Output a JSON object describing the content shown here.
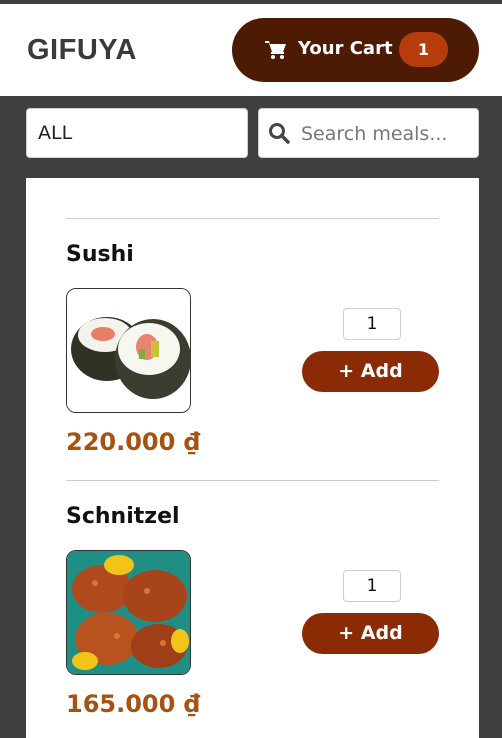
{
  "header": {
    "logo": "GIFUYA",
    "cart": {
      "label": "Your Cart",
      "count": "1",
      "icon": "shopping-cart-icon"
    }
  },
  "filters": {
    "category": "ALL",
    "search": {
      "placeholder": "Search meals...",
      "icon": "search-icon"
    }
  },
  "meals": [
    {
      "name": "Sushi",
      "quantity": "1",
      "add_label": "+ Add",
      "price": "220.000 ₫"
    },
    {
      "name": "Schnitzel",
      "quantity": "1",
      "add_label": "+ Add",
      "price": "165.000 ₫"
    }
  ],
  "colors": {
    "cart_button": "#4d1a04",
    "cart_badge": "#b63c0c",
    "add_button": "#8a2b05",
    "price": "#a55212",
    "background": "#3f3f3f"
  }
}
